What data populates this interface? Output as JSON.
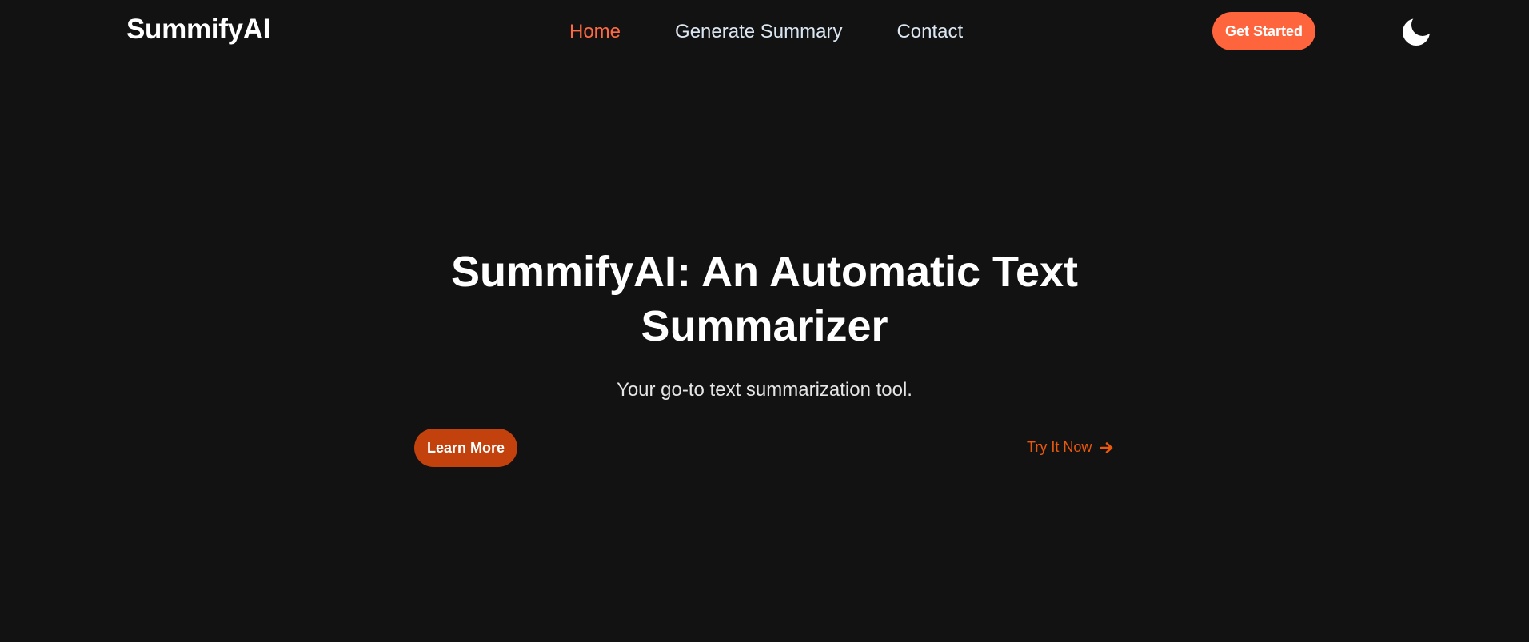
{
  "header": {
    "brand": "SummifyAI",
    "nav": [
      {
        "label": "Home"
      },
      {
        "label": "Generate Summary"
      },
      {
        "label": "Contact"
      }
    ],
    "cta_label": "Get Started",
    "theme_icon": "moon-icon"
  },
  "hero": {
    "title_line1": "SummifyAI: An Automatic Text",
    "title_line2": "Summarizer",
    "subtitle": "Your go-to text summarization tool.",
    "primary_button": "Learn More",
    "secondary_link": "Try It Now",
    "secondary_icon": "arrow-right-icon"
  },
  "colors": {
    "background": "#121212",
    "accent": "#ff653d",
    "accent_dark": "#c2410c",
    "link_orange": "#ea580c",
    "nav_text": "#dbe6f3"
  }
}
